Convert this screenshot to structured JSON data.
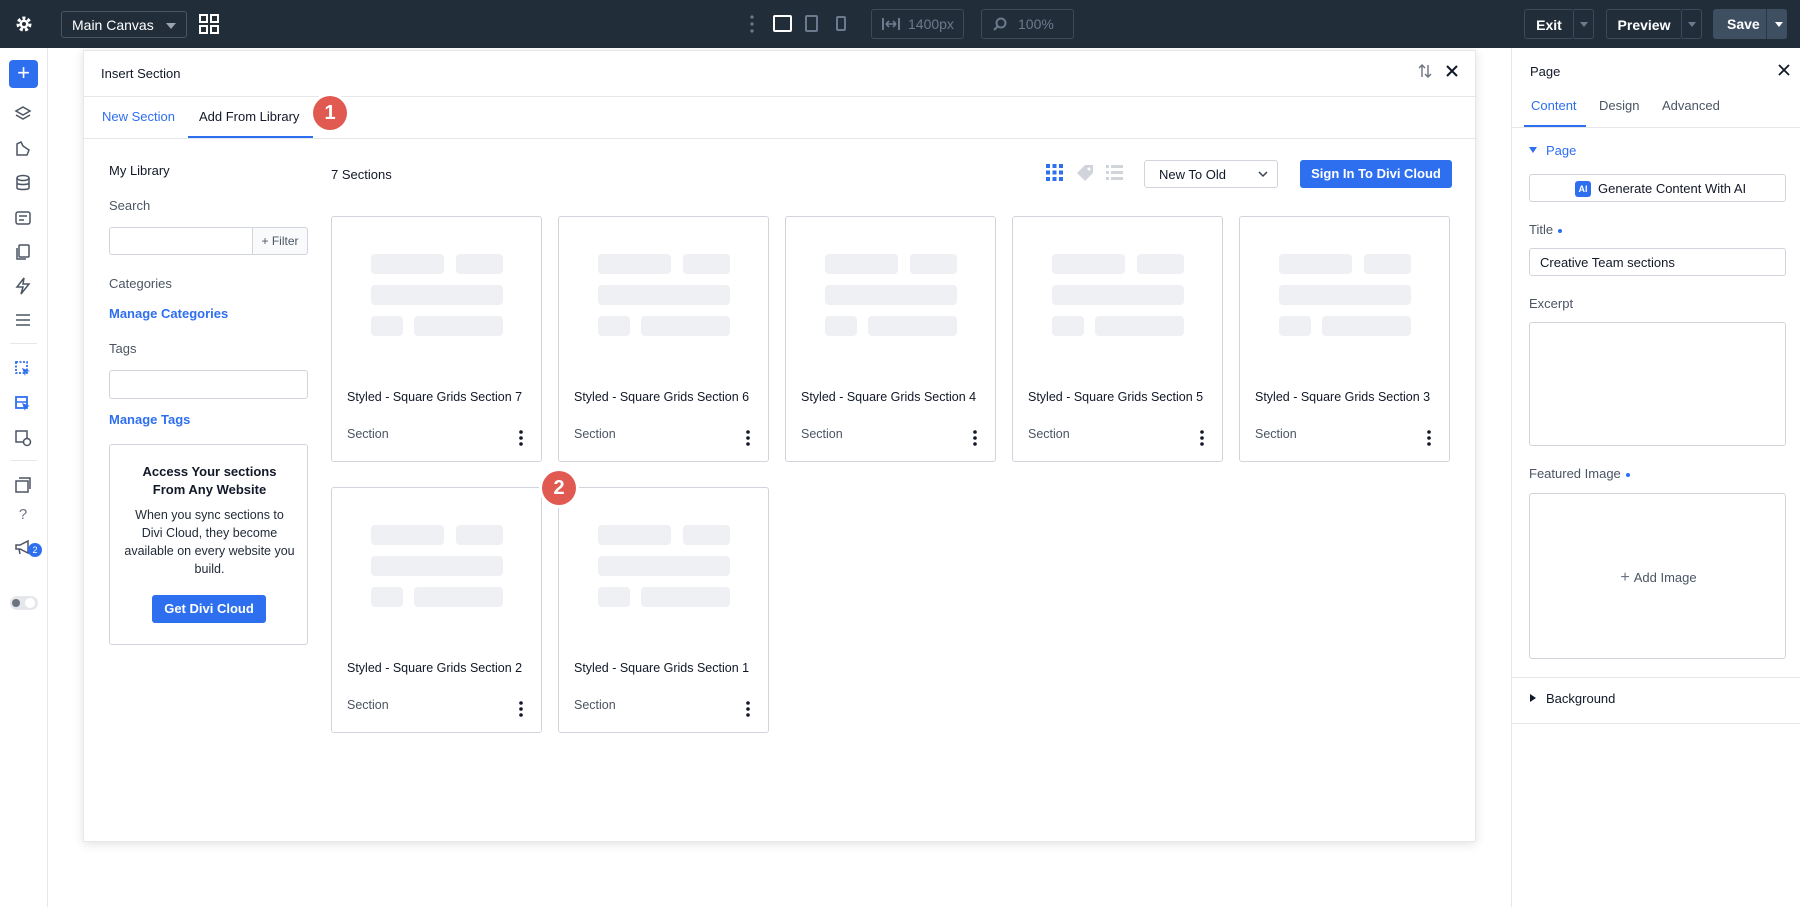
{
  "topbar": {
    "canvas_select": "Main Canvas",
    "width_value": "1400px",
    "zoom_value": "100%",
    "exit_label": "Exit",
    "preview_label": "Preview",
    "save_label": "Save"
  },
  "rail": {
    "notification_count": "2",
    "help_label": "?"
  },
  "modal": {
    "title": "Insert Section",
    "tabs": [
      {
        "label": "New Section"
      },
      {
        "label": "Add From Library"
      }
    ],
    "markers": [
      "1",
      "2"
    ],
    "library": {
      "heading": "My Library",
      "search_label": "Search",
      "filter_label": "+ Filter",
      "categories_label": "Categories",
      "manage_categories": "Manage Categories",
      "tags_label": "Tags",
      "manage_tags": "Manage Tags",
      "promo_title": "Access Your sections From Any Website",
      "promo_text": "When you sync sections to Divi Cloud, they become available on every website you build.",
      "promo_button": "Get Divi Cloud"
    },
    "sections_count": "7 Sections",
    "sort_value": "New To Old",
    "signin_button": "Sign In To Divi Cloud",
    "cards": [
      {
        "name": "Styled - Square Grids Section 7",
        "type": "Section"
      },
      {
        "name": "Styled - Square Grids Section 6",
        "type": "Section"
      },
      {
        "name": "Styled - Square Grids Section 4",
        "type": "Section"
      },
      {
        "name": "Styled - Square Grids Section 5",
        "type": "Section"
      },
      {
        "name": "Styled - Square Grids Section 3",
        "type": "Section"
      },
      {
        "name": "Styled - Square Grids Section 2",
        "type": "Section"
      },
      {
        "name": "Styled - Square Grids Section 1",
        "type": "Section"
      }
    ]
  },
  "panel": {
    "title": "Page",
    "tabs": [
      {
        "label": "Content"
      },
      {
        "label": "Design"
      },
      {
        "label": "Advanced"
      }
    ],
    "page_group": "Page",
    "ai_button": "Generate Content With AI",
    "ai_icon": "AI",
    "title_label": "Title",
    "title_value": "Creative Team sections",
    "excerpt_label": "Excerpt",
    "featured_label": "Featured Image",
    "add_image": "Add Image",
    "background_group": "Background"
  },
  "colors": {
    "accent": "#2e6ff0",
    "topbar": "#222d3a",
    "marker": "#e05a52"
  }
}
